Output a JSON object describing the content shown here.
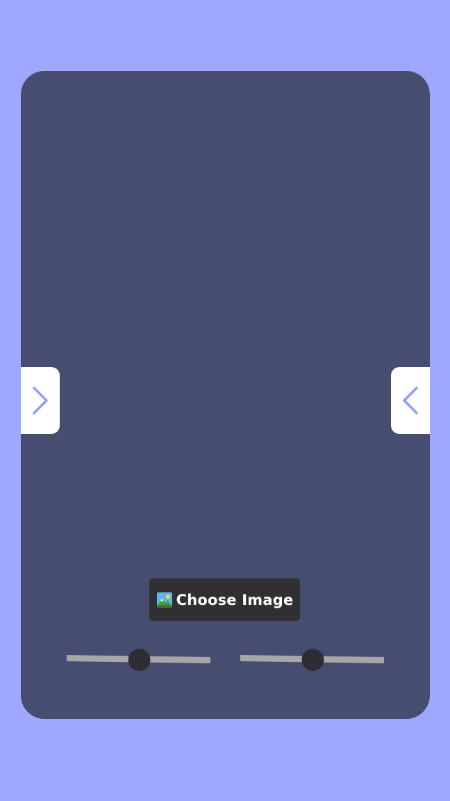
{
  "colors": {
    "page_background": "#9fa8fe",
    "card_background": "#474d70",
    "nav_button_background": "#ffffff",
    "chevron_color": "#8f9bfa",
    "choose_button_background": "#302f32",
    "slider_track": "#a7a7a7",
    "slider_thumb": "#2e2d33"
  },
  "nav": {
    "left_icon": "chevron-right-icon",
    "right_icon": "chevron-left-icon"
  },
  "choose_image": {
    "icon": "picture-icon",
    "label": "Choose Image"
  },
  "sliders": [
    {
      "name": "slider-1",
      "value": 0.5
    },
    {
      "name": "slider-2",
      "value": 0.5
    }
  ]
}
